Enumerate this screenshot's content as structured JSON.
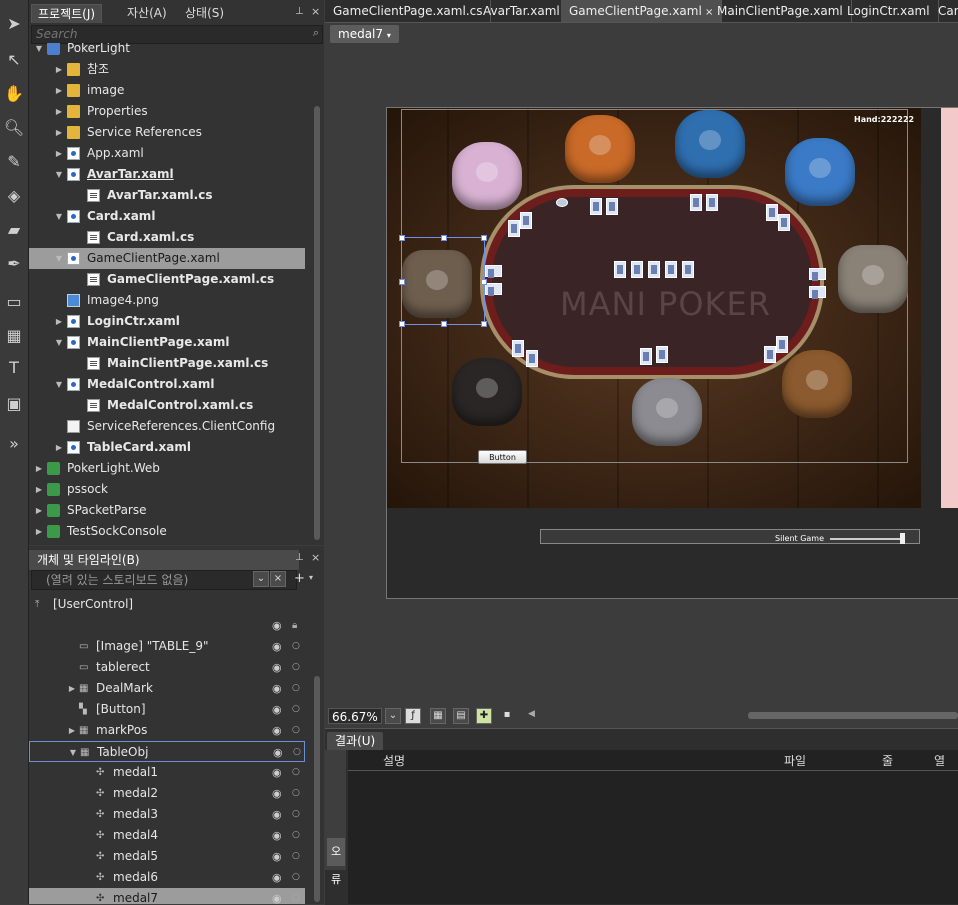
{
  "project_panel": {
    "tabs": [
      "프로젝트(J)",
      "자산(A)",
      "상태(S)"
    ],
    "search_placeholder": "Search",
    "tree": [
      {
        "label": "PokerLight",
        "depth": 0,
        "icon": "project-icon",
        "arrow": "expanded"
      },
      {
        "label": "참조",
        "depth": 1,
        "icon": "folder-icon",
        "arrow": "collapsed"
      },
      {
        "label": "image",
        "depth": 1,
        "icon": "folder-icon",
        "arrow": "collapsed"
      },
      {
        "label": "Properties",
        "depth": 1,
        "icon": "folder-icon",
        "arrow": "collapsed"
      },
      {
        "label": "Service References",
        "depth": 1,
        "icon": "folder-icon",
        "arrow": "collapsed"
      },
      {
        "label": "App.xaml",
        "depth": 1,
        "icon": "xaml-icon",
        "arrow": "collapsed"
      },
      {
        "label": "AvarTar.xaml",
        "depth": 1,
        "icon": "xaml-icon",
        "arrow": "expanded",
        "bold": true,
        "underline": true
      },
      {
        "label": "AvarTar.xaml.cs",
        "depth": 2,
        "icon": "cs-file-icon",
        "bold": true
      },
      {
        "label": "Card.xaml",
        "depth": 1,
        "icon": "xaml-icon",
        "arrow": "expanded",
        "bold": true
      },
      {
        "label": "Card.xaml.cs",
        "depth": 2,
        "icon": "cs-file-icon",
        "bold": true
      },
      {
        "label": "GameClientPage.xaml",
        "depth": 1,
        "icon": "xaml-icon",
        "arrow": "expanded",
        "selected": true
      },
      {
        "label": "GameClientPage.xaml.cs",
        "depth": 2,
        "icon": "cs-file-icon",
        "bold": true
      },
      {
        "label": "Image4.png",
        "depth": 1,
        "icon": "png-icon"
      },
      {
        "label": "LoginCtr.xaml",
        "depth": 1,
        "icon": "xaml-icon",
        "arrow": "collapsed",
        "bold": true
      },
      {
        "label": "MainClientPage.xaml",
        "depth": 1,
        "icon": "xaml-icon",
        "arrow": "expanded",
        "bold": true
      },
      {
        "label": "MainClientPage.xaml.cs",
        "depth": 2,
        "icon": "cs-file-icon",
        "bold": true
      },
      {
        "label": "MedalControl.xaml",
        "depth": 1,
        "icon": "xaml-icon",
        "arrow": "expanded",
        "bold": true
      },
      {
        "label": "MedalControl.xaml.cs",
        "depth": 2,
        "icon": "cs-file-icon",
        "bold": true
      },
      {
        "label": "ServiceReferences.ClientConfig",
        "depth": 1,
        "icon": "config-icon"
      },
      {
        "label": "TableCard.xaml",
        "depth": 1,
        "icon": "xaml-icon",
        "arrow": "collapsed",
        "bold": true
      },
      {
        "label": "PokerLight.Web",
        "depth": 0,
        "icon": "web-project-icon",
        "arrow": "collapsed"
      },
      {
        "label": "pssock",
        "depth": 0,
        "icon": "web-project-icon",
        "arrow": "collapsed"
      },
      {
        "label": "SPacketParse",
        "depth": 0,
        "icon": "web-project-icon",
        "arrow": "collapsed"
      },
      {
        "label": "TestSockConsole",
        "depth": 0,
        "icon": "web-project-icon",
        "arrow": "collapsed"
      }
    ]
  },
  "objects_panel": {
    "title": "개체 및 타임라인(B)",
    "storyboard": "(열려 있는 스토리보드 없음)",
    "root": "[UserControl]",
    "items": [
      {
        "label": "[Image] \"TABLE_9\"",
        "depth": 1,
        "icon": "image-icon"
      },
      {
        "label": "tablerect",
        "depth": 1,
        "icon": "rect-icon"
      },
      {
        "label": "DealMark",
        "depth": 1,
        "icon": "grid-icon",
        "arrow": "collapsed"
      },
      {
        "label": "[Button]",
        "depth": 1,
        "icon": "button-icon"
      },
      {
        "label": "markPos",
        "depth": 1,
        "icon": "grid-icon",
        "arrow": "collapsed"
      },
      {
        "label": "TableObj",
        "depth": 1,
        "icon": "grid-icon",
        "arrow": "expanded",
        "outlined": true
      },
      {
        "label": "medal1",
        "depth": 2,
        "icon": "medal-icon"
      },
      {
        "label": "medal2",
        "depth": 2,
        "icon": "medal-icon"
      },
      {
        "label": "medal3",
        "depth": 2,
        "icon": "medal-icon"
      },
      {
        "label": "medal4",
        "depth": 2,
        "icon": "medal-icon"
      },
      {
        "label": "medal5",
        "depth": 2,
        "icon": "medal-icon"
      },
      {
        "label": "medal6",
        "depth": 2,
        "icon": "medal-icon"
      },
      {
        "label": "medal7",
        "depth": 2,
        "icon": "medal-icon",
        "selected": true
      }
    ]
  },
  "doc_tabs": [
    {
      "label": "GameClientPage.xaml.cs"
    },
    {
      "label": "AvarTar.xaml"
    },
    {
      "label": "GameClientPage.xaml",
      "active": true,
      "close": "×"
    },
    {
      "label": "MainClientPage.xaml"
    },
    {
      "label": "LoginCtr.xaml"
    },
    {
      "label": "Car"
    }
  ],
  "breadcrumb_selector": "medal7",
  "canvas": {
    "hand_label": "Hand:222222",
    "table_title": "MANI POKER",
    "button_label": "Button",
    "silent_label": "Silent Game"
  },
  "zoom": "66.67%",
  "results_panel": {
    "tab": "결과(U)",
    "side_tab": "오류",
    "columns": [
      "설명",
      "파일",
      "줄",
      "열"
    ]
  },
  "colors": {
    "selection": "#9c9c9c",
    "outline_blue": "#6b8fd6",
    "felt": "#3a2426",
    "felt_rim": "#6e1d1d"
  }
}
